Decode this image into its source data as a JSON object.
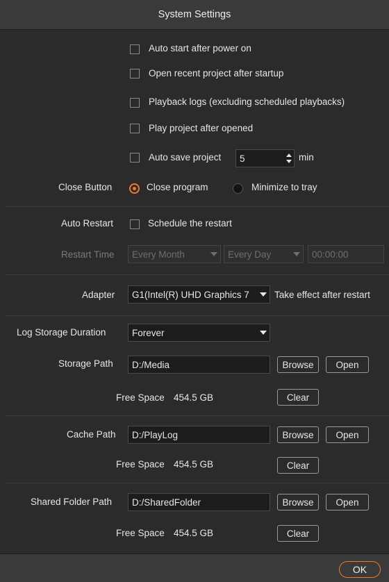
{
  "window": {
    "title": "System Settings"
  },
  "options": {
    "auto_start": "Auto start after power on",
    "open_recent": "Open recent project after startup",
    "playback_logs": "Playback logs (excluding scheduled playbacks)",
    "play_after_open": "Play project after opened",
    "auto_save": "Auto save project",
    "auto_save_value": "5",
    "auto_save_unit": "min"
  },
  "close_button": {
    "label": "Close Button",
    "option_close": "Close program",
    "option_minimize": "Minimize to tray",
    "selected": "Close program"
  },
  "auto_restart": {
    "label": "Auto Restart",
    "schedule": "Schedule the restart",
    "restart_time_label": "Restart Time",
    "month": "Every Month",
    "day": "Every Day",
    "time": "00:00:00"
  },
  "adapter": {
    "label": "Adapter",
    "value": "G1(Intel(R) UHD Graphics 7",
    "note": "Take effect after restart"
  },
  "log": {
    "label": "Log Storage Duration",
    "value": "Forever"
  },
  "storage": {
    "label": "Storage Path",
    "path": "D:/Media",
    "free_label": "Free Space",
    "free_value": "454.5 GB"
  },
  "cache": {
    "label": "Cache Path",
    "path": "D:/PlayLog",
    "free_label": "Free Space",
    "free_value": "454.5 GB"
  },
  "shared": {
    "label": "Shared Folder Path",
    "path": "D:/SharedFolder",
    "free_label": "Free Space",
    "free_value": "454.5 GB"
  },
  "buttons": {
    "browse": "Browse",
    "open": "Open",
    "clear": "Clear",
    "ok": "OK"
  },
  "colors": {
    "accent": "#f07a2a",
    "background": "#2b2b2b",
    "titlebar": "#3a3a3a"
  }
}
